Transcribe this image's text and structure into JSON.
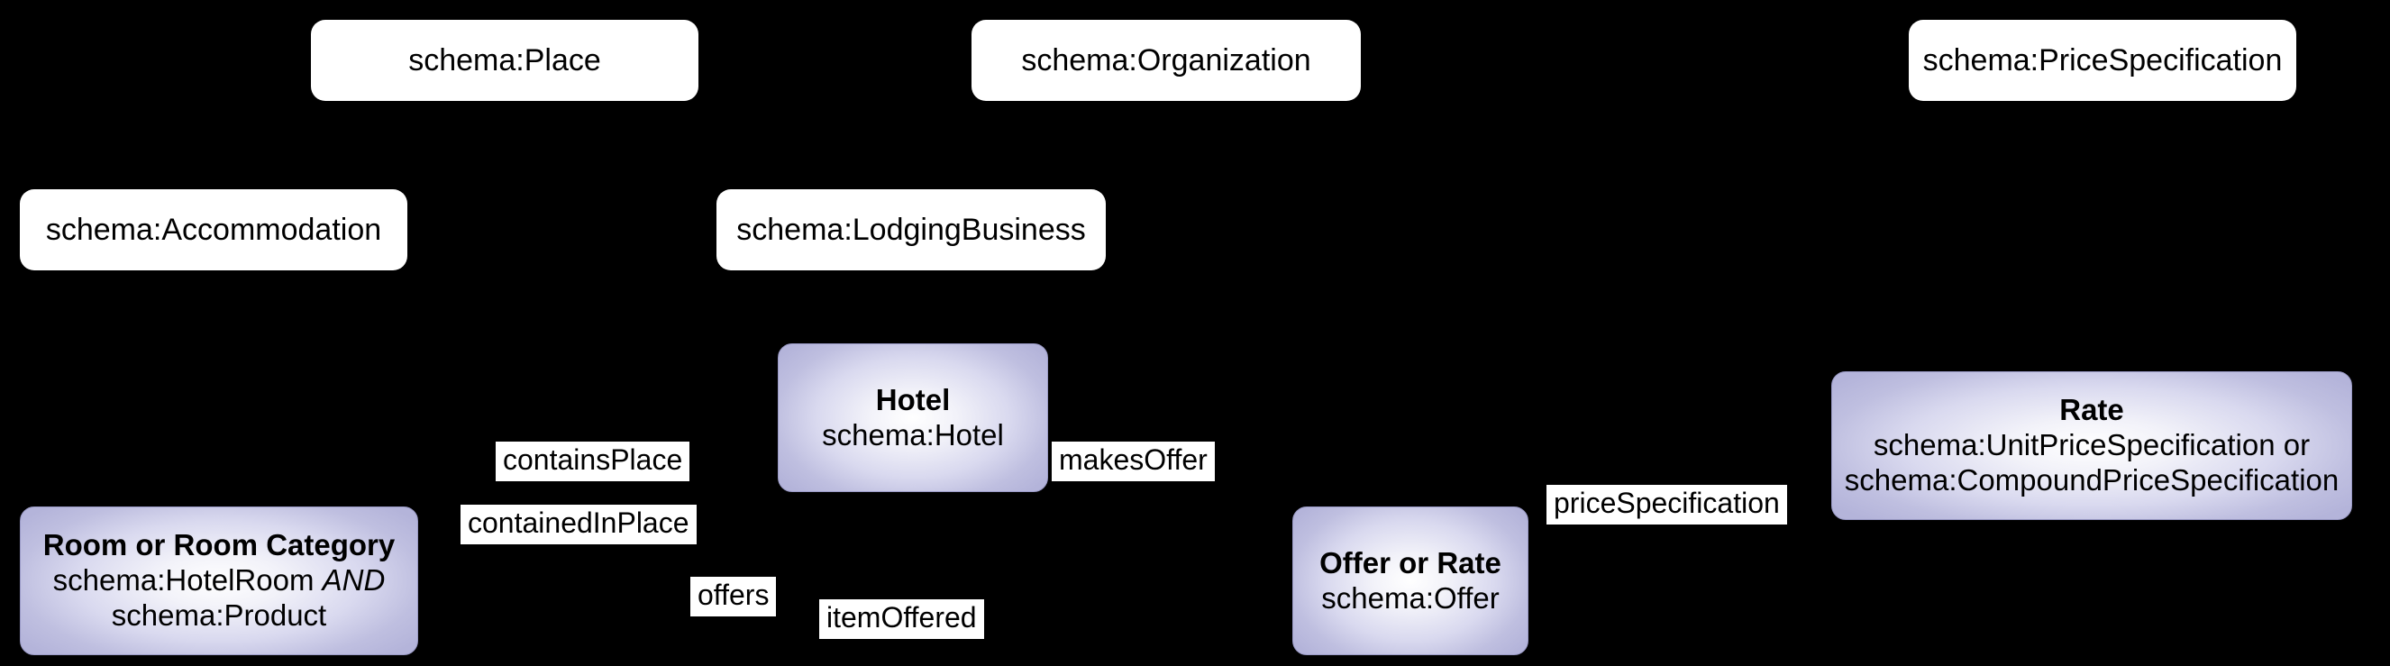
{
  "diagram": {
    "title": "Schema.org hotel ontology class diagram",
    "background_color": "#000000",
    "entity_fill_color": "#c3c3e4",
    "plain_fill_color": "#ffffff",
    "text_color": "#000000"
  },
  "nodes": {
    "place": {
      "label": "schema:Place",
      "kind": "superclass"
    },
    "organization": {
      "label": "schema:Organization",
      "kind": "superclass"
    },
    "price_specification": {
      "label": "schema:PriceSpecification",
      "kind": "superclass"
    },
    "accommodation": {
      "label": "schema:Accommodation",
      "kind": "superclass"
    },
    "lodging_business": {
      "label": "schema:LodgingBusiness",
      "kind": "superclass"
    },
    "hotel": {
      "title": "Hotel",
      "subtitle": "schema:Hotel",
      "kind": "entity"
    },
    "room": {
      "title": "Room or Room Category",
      "subtitle_1_pre": "schema:HotelRoom ",
      "subtitle_1_em": "AND",
      "subtitle_2": "schema:Product",
      "kind": "entity"
    },
    "offer": {
      "title": "Offer or Rate",
      "subtitle": "schema:Offer",
      "kind": "entity"
    },
    "rate": {
      "title": "Rate",
      "subtitle_1": "schema:UnitPriceSpecification or",
      "subtitle_2": "schema:CompoundPriceSpecification",
      "kind": "entity"
    }
  },
  "edge_labels": {
    "contains_place": "containsPlace",
    "contained_in_place": "containedInPlace",
    "makes_offer": "makesOffer",
    "offers": "offers",
    "item_offered": "itemOffered",
    "price_specification": "priceSpecification"
  }
}
